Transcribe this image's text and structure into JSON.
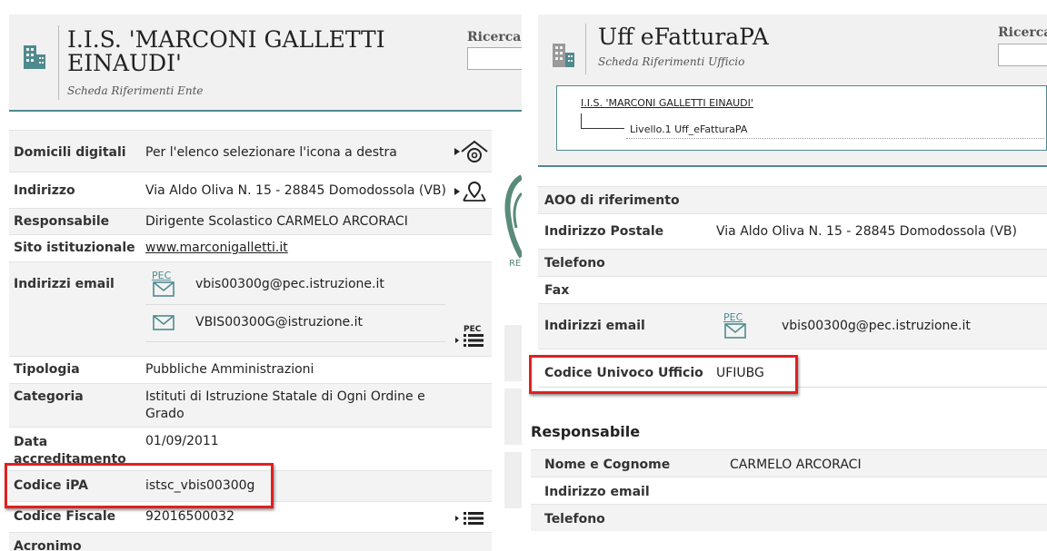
{
  "left": {
    "title_line1": "I.I.S. 'MARCONI GALLETTI",
    "title_line2": "EINAUDI'",
    "subtitle": "Scheda Riferimenti Ente",
    "search_label": "Ricerca n",
    "rows": {
      "domicili": {
        "label": "Domicili digitali",
        "value": "Per l'elenco selezionare l'icona a destra"
      },
      "indirizzo": {
        "label": "Indirizzo",
        "value": "Via Aldo Oliva N. 15 - 28845 Domodossola (VB)"
      },
      "responsabile": {
        "label": "Responsabile",
        "value": "Dirigente Scolastico CARMELO ARCORACI"
      },
      "sito": {
        "label": "Sito istituzionale",
        "value": "www.marconigalletti.it"
      },
      "email": {
        "label": "Indirizzi email",
        "pec_tag": "PEC",
        "pec": "vbis00300g@pec.istruzione.it",
        "peo": "VBIS00300G@istruzione.it",
        "list_tag": "PEC"
      },
      "tipologia": {
        "label": "Tipologia",
        "value": "Pubbliche Amministrazioni"
      },
      "categoria": {
        "label": "Categoria",
        "value": "Istituti di Istruzione Statale di Ogni Ordine e Grado"
      },
      "data": {
        "label_line1": "Data",
        "label_line2": "accreditamento",
        "value": "01/09/2011"
      },
      "ipa": {
        "label": "Codice iPA",
        "value": "istsc_vbis00300g"
      },
      "fiscale": {
        "label": "Codice Fiscale",
        "value": "92016500032"
      },
      "acronimo": {
        "label": "Acronimo"
      }
    }
  },
  "right": {
    "title": "Uff  eFatturaPA",
    "subtitle": "Scheda Riferimenti Ufficio",
    "search_label": "Ricerca n",
    "tree": {
      "root": "I.I.S. 'MARCONI GALLETTI EINAUDI'",
      "level": "Livello.1 Uff_eFatturaPA"
    },
    "rows": {
      "aoo": {
        "label": "AOO di riferimento"
      },
      "postale": {
        "label": "Indirizzo Postale",
        "value": "Via Aldo Oliva N. 15 - 28845 Domodossola (VB)"
      },
      "telefono": {
        "label": "Telefono"
      },
      "fax": {
        "label": "Fax"
      },
      "email": {
        "label": "Indirizzi email",
        "pec_tag": "PEC",
        "pec": "vbis00300g@pec.istruzione.it"
      },
      "codice": {
        "label": "Codice Univoco Ufficio",
        "value": "UFIUBG"
      }
    },
    "responsabile": {
      "heading": "Responsabile",
      "nome": {
        "label": "Nome e Cognome",
        "value": "CARMELO ARCORACI"
      },
      "email": {
        "label": "Indirizzo email"
      },
      "telefono": {
        "label": "Telefono"
      }
    }
  },
  "colors": {
    "accent": "#4f8a8f",
    "highlight": "#e02020",
    "row_bg": "#f3f3f3"
  }
}
